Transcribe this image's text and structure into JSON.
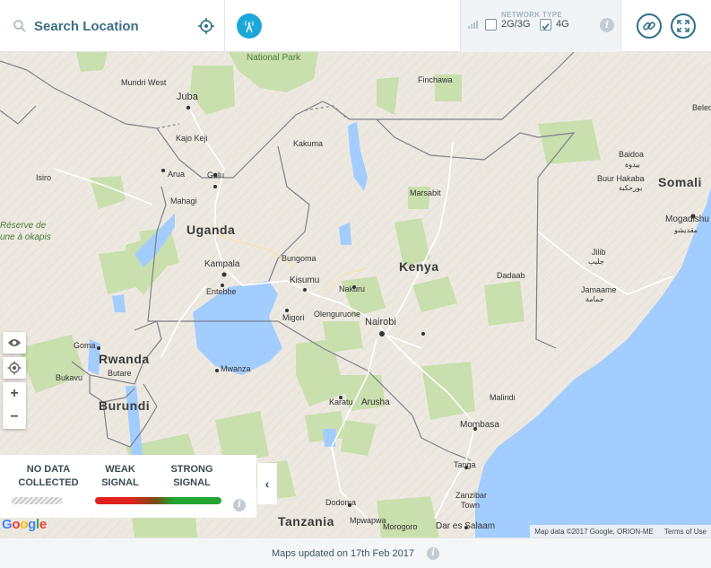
{
  "search": {
    "placeholder": "Search Location"
  },
  "network_type": {
    "title": "NETWORK TYPE",
    "options": [
      {
        "label": "2G/3G",
        "checked": false
      },
      {
        "label": "4G",
        "checked": true
      }
    ]
  },
  "map": {
    "labels": {
      "national_park": "National Park",
      "mundri_west": "Mundri West",
      "juba": "Juba",
      "finchawa": "Finchawa",
      "beled": "Beled",
      "kajo_keji": "Kajo Keji",
      "kakuma": "Kakuma",
      "baidoa": "Baidoa",
      "baidoa_ar": "بيدوة",
      "arua": "Arua",
      "gulu": "Gulu",
      "isiro": "Isiro",
      "mahagi": "Mahagi",
      "buur_hakaba": "Buur Hakaba",
      "buur_hakaba_ar": "بورحكبة",
      "somalia": "Somali",
      "marsabit": "Marsabit",
      "reserve_1": "Réserve de",
      "reserve_2": "une à okapis",
      "mogadishu": "Mogadishu",
      "mogadishu_ar": "مقديشو",
      "uganda": "Uganda",
      "jilib": "Jilib",
      "jilib_ar": "جليب",
      "bungoma": "Bungoma",
      "kenya": "Kenya",
      "kampala": "Kampala",
      "dadaab": "Dadaab",
      "entebbe": "Entebbe",
      "kisumu": "Kisumu",
      "nakuru": "Nakuru",
      "jamaame": "Jamaame",
      "jamaame_ar": "جمامة",
      "migori": "Migori",
      "olenguruone": "Olenguruone",
      "nairobi": "Nairobi",
      "goma": "Goma",
      "rwanda": "Rwanda",
      "butare": "Butare",
      "bukavu": "Bukavu",
      "mwanza": "Mwanza",
      "burundi": "Burundi",
      "malindi": "Malindi",
      "karatu": "Karatu",
      "arusha": "Arusha",
      "mombasa": "Mombasa",
      "tanga": "Tanga",
      "zanzibar_1": "Zanzibar",
      "zanzibar_2": "Town",
      "dodoma": "Dodoma",
      "tanzania": "Tanzania",
      "mpwapwa": "Mpwapwa",
      "morogoro": "Morogoro",
      "dar_es_salaam": "Dar es Salaam"
    }
  },
  "legend": {
    "no_data": "NO DATA COLLECTED",
    "weak": "WEAK SIGNAL",
    "strong": "STRONG SIGNAL"
  },
  "attribution": {
    "google": "Google",
    "map_data": "Map data ©2017 Google, ORION-ME",
    "terms": "Terms of Use"
  },
  "footer": {
    "text": "Maps updated on 17th Feb 2017"
  },
  "colors": {
    "accent": "#2f6f86",
    "tower": "#1ba8d8",
    "water": "#a3ccff",
    "land": "#ede9e1",
    "park": "#c9dfae",
    "weak_signal": "#e0201d",
    "strong_signal": "#23a532"
  }
}
